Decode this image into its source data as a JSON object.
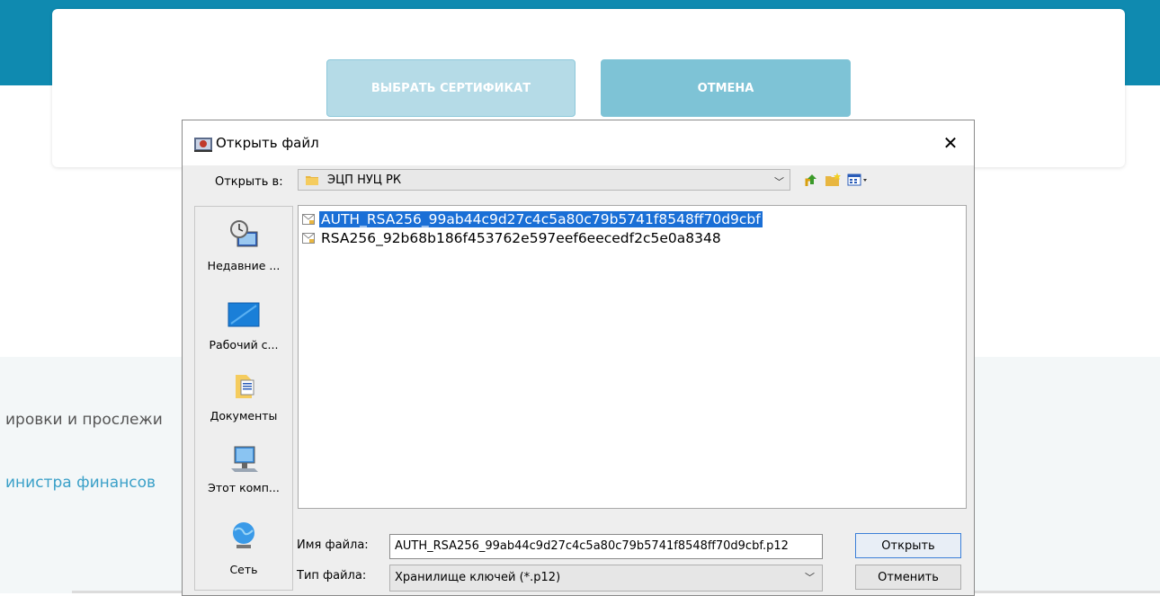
{
  "page": {
    "select_cert_label": "ВЫБРАТЬ СЕРТИФИКАТ",
    "cancel_label": "ОТМЕНА",
    "background_text_1": "ировки и прослежи",
    "background_text_2": "инистра финансов"
  },
  "dialog": {
    "title": "Открыть файл",
    "close_glyph": "✕",
    "look_in_label": "Открыть в:",
    "look_in_value": "ЭЦП НУЦ РК",
    "places": [
      {
        "label": "Недавние ...",
        "icon": "recent-items-icon"
      },
      {
        "label": "Рабочий с...",
        "icon": "desktop-icon"
      },
      {
        "label": "Документы",
        "icon": "documents-icon"
      },
      {
        "label": "Этот комп...",
        "icon": "computer-icon"
      },
      {
        "label": "Сеть",
        "icon": "network-icon"
      }
    ],
    "files": [
      {
        "name": "AUTH_RSA256_99ab44c9d27c4c5a80c79b5741f8548ff70d9cbf",
        "selected": true
      },
      {
        "name": "RSA256_92b68b186f453762e597eef6eecedf2c5e0a8348",
        "selected": false
      }
    ],
    "file_name_label": "Имя файла:",
    "file_name_value": "AUTH_RSA256_99ab44c9d27c4c5a80c79b5741f8548ff70d9cbf.p12",
    "file_type_label": "Тип файла:",
    "file_type_value": "Хранилище ключей (*.p12)",
    "open_label": "Открыть",
    "cancel_label": "Отменить"
  },
  "colors": {
    "header_band": "#0f8ab0",
    "select_button": "#b5dbe7",
    "cancel_button": "#7ec3d6",
    "selection": "#1a6fd6",
    "link_text": "#3aa0c8"
  }
}
